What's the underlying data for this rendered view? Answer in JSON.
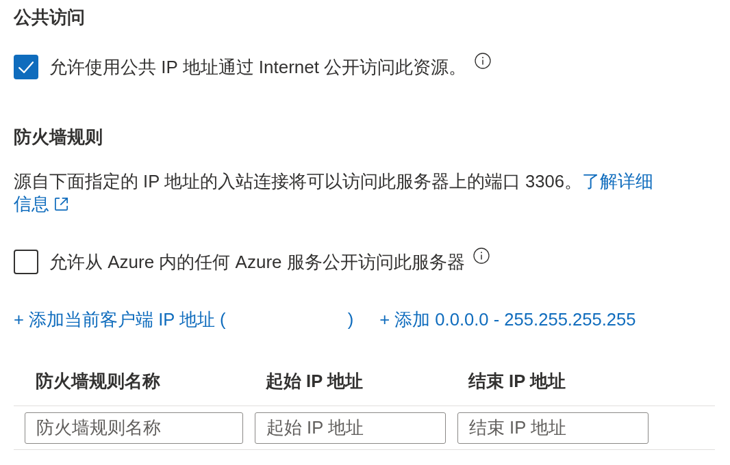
{
  "public_access": {
    "heading": "公共访问",
    "checkbox": {
      "label": "允许使用公共 IP 地址通过 Internet 公开访问此资源。",
      "checked": true,
      "info": true
    }
  },
  "firewall_rules": {
    "heading": "防火墙规则",
    "description": "源自下面指定的 IP 地址的入站连接将可以访问此服务器上的端口 3306。",
    "learn_more_link": [
      "了解详细",
      "信息"
    ],
    "azure_checkbox": {
      "label": "允许从 Azure 内的任何 Azure 服务公开访问此服务器",
      "checked": false,
      "info": true
    },
    "add_links": [
      {
        "text_parts": [
          "+ 添加当前客户端 IP 地址 (",
          ")"
        ]
      },
      {
        "text_parts": [
          "+ 添加 0.0.0.0 - 255.255.255.255"
        ]
      }
    ],
    "table": {
      "columns": [
        "防火墙规则名称",
        "起始 IP 地址",
        "结束 IP 地址"
      ],
      "new_row": [
        {
          "placeholder": "防火墙规则名称"
        },
        {
          "placeholder": "起始 IP 地址"
        },
        {
          "placeholder": "结束 IP 地址"
        }
      ]
    }
  }
}
